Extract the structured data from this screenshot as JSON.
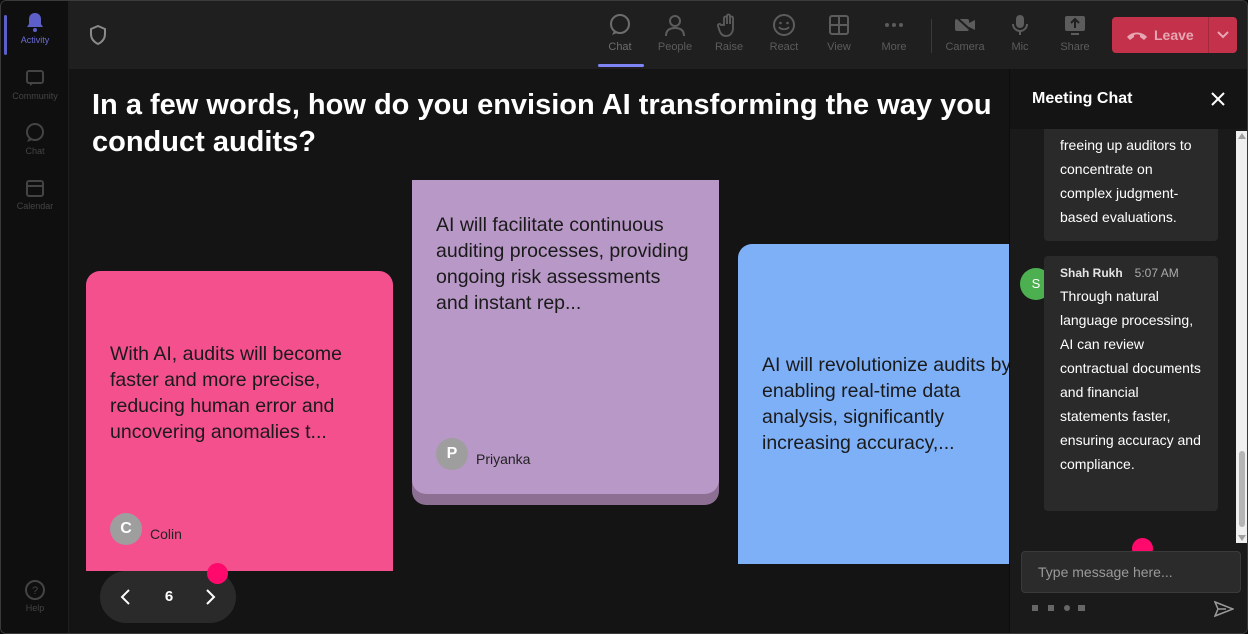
{
  "rail": {
    "items": [
      {
        "label": "Activity",
        "icon": "bell-icon"
      },
      {
        "label": "Community",
        "icon": "community-icon"
      },
      {
        "label": "Chat",
        "icon": "chat-icon"
      },
      {
        "label": "Calendar",
        "icon": "calendar-icon"
      }
    ],
    "help": "Help"
  },
  "toolbar": {
    "chat": "Chat",
    "people": "People",
    "raise": "Raise",
    "react": "React",
    "view": "View",
    "more": "More",
    "camera": "Camera",
    "mic": "Mic",
    "share": "Share",
    "leave": "Leave"
  },
  "question": "In a few words, how do you envision AI transforming the way you conduct audits?",
  "cards": [
    {
      "text": "With AI, audits will become faster and more precise, reducing human error and uncovering anomalies t...",
      "author": "Colin",
      "initial": "C",
      "color": "#f4508e"
    },
    {
      "text": "AI will facilitate continuous auditing processes, providing ongoing risk assessments and instant rep...",
      "author": "Priyanka",
      "initial": "P",
      "color": "#b898c7"
    },
    {
      "text": "AI will revolutionize audits by enabling real-time data analysis, significantly increasing accuracy,...",
      "color": "#7eb0f8"
    }
  ],
  "pager": {
    "page": "6"
  },
  "chat": {
    "title": "Meeting Chat",
    "messages": [
      {
        "text": "freeing up auditors to concentrate on complex judgment-based evaluations."
      },
      {
        "sender": "Shah Rukh",
        "initial": "S",
        "time": "5:07 AM",
        "text": "Through natural language processing, AI can review contractual documents and financial statements faster, ensuring accuracy and compliance."
      }
    ],
    "input_placeholder": "Type message here..."
  },
  "colors": {
    "accent": "#7f85f5",
    "leave": "#c4314b",
    "dot": "#ff0a6c"
  }
}
